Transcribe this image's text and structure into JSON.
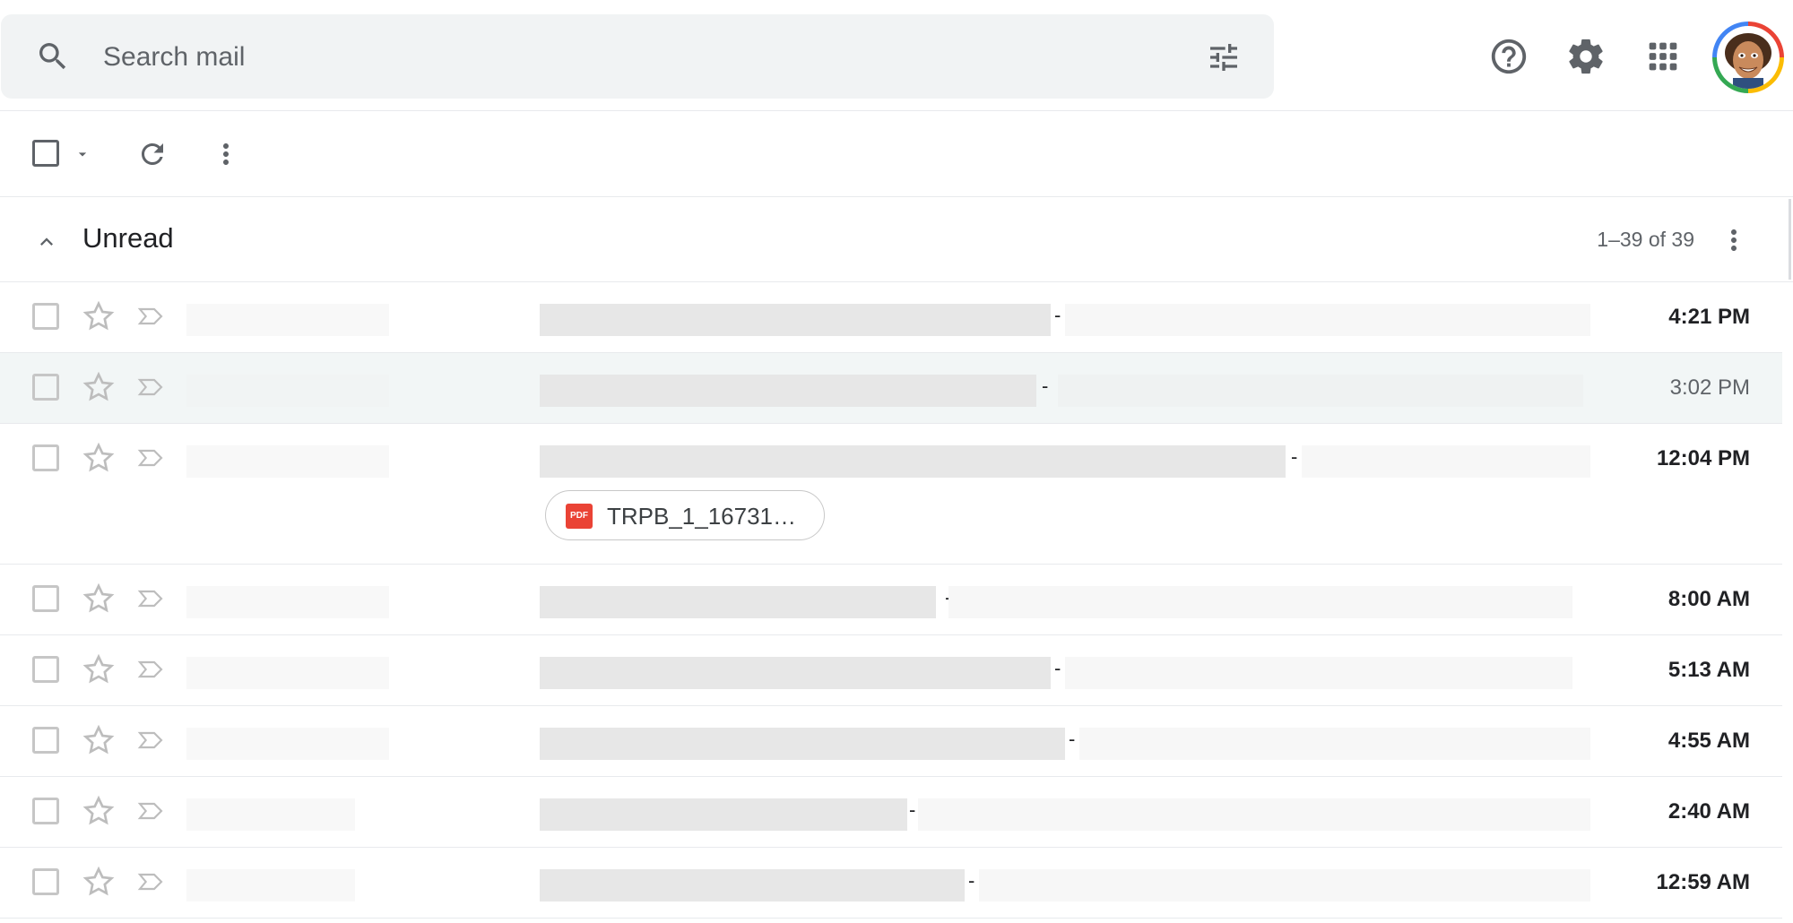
{
  "search": {
    "placeholder": "Search mail"
  },
  "toolbar": {
    "icons": [
      "select-checkbox",
      "select-caret",
      "refresh-icon",
      "more-vert-icon"
    ]
  },
  "section": {
    "title": "Unread",
    "count": "1–39 of 39"
  },
  "rows": [
    {
      "time": "4:21 PM",
      "unread": true
    },
    {
      "time": "3:02 PM",
      "unread": false
    },
    {
      "time": "12:04 PM",
      "unread": true,
      "attachment": "TRPB_1_16731…"
    },
    {
      "time": "8:00 AM",
      "unread": true
    },
    {
      "time": "5:13 AM",
      "unread": true
    },
    {
      "time": "4:55 AM",
      "unread": true
    },
    {
      "time": "2:40 AM",
      "unread": true
    },
    {
      "time": "12:59 AM",
      "unread": true
    }
  ],
  "colors": {
    "accent": "#ea4335",
    "toolbar_bg": "#f1f3f4",
    "divider": "#e8eaed"
  }
}
